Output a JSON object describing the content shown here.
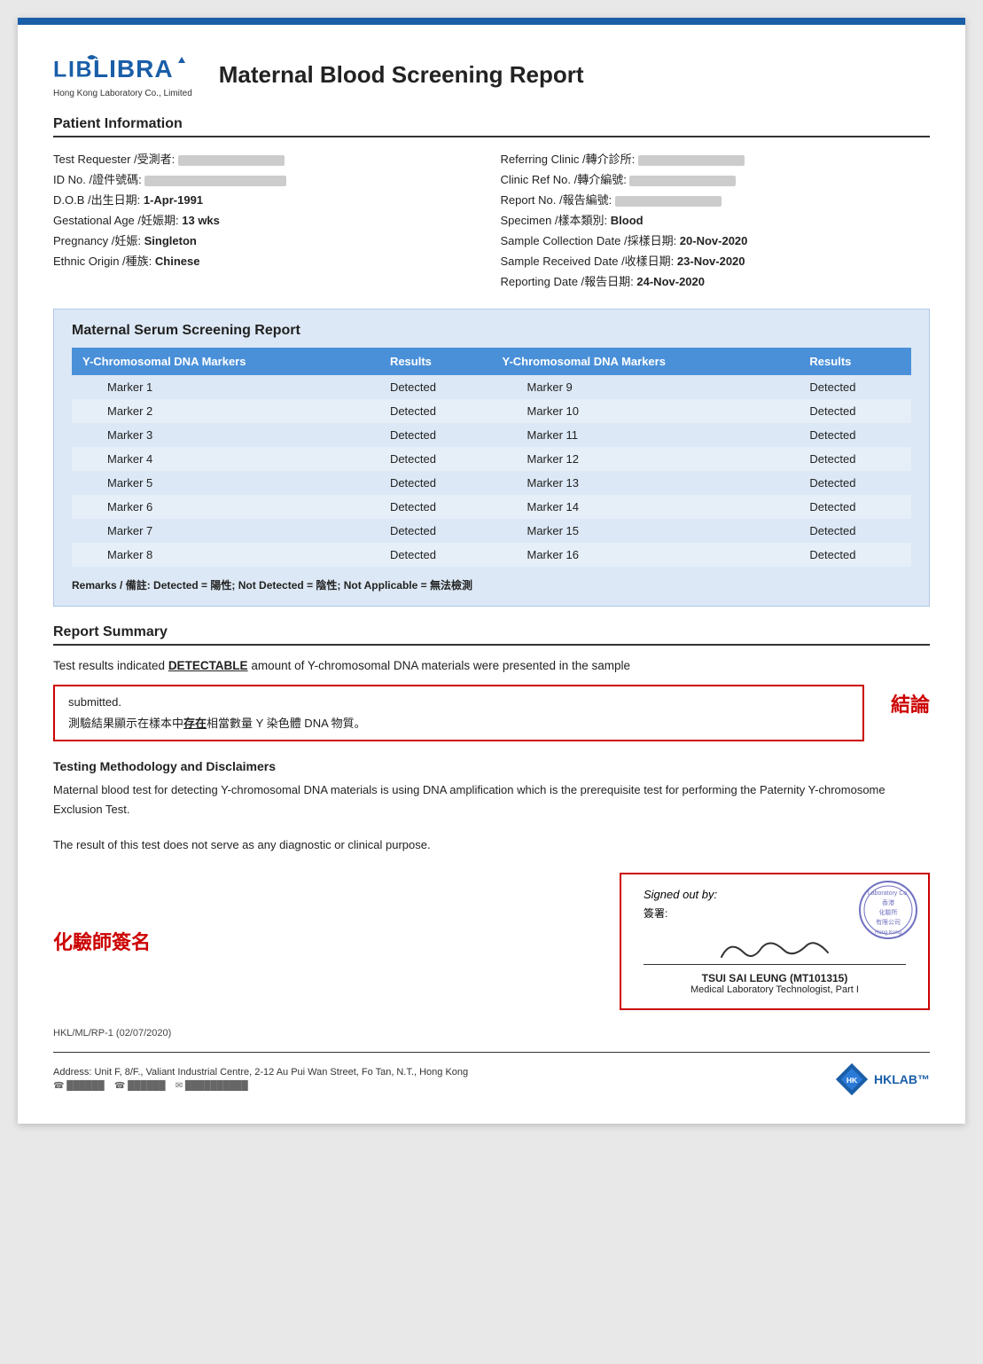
{
  "page": {
    "title": "Maternal Blood Screening Report"
  },
  "logo": {
    "name": "LIBRA",
    "subtitle": "Hong Kong Laboratory Co., Limited"
  },
  "patient_info": {
    "section_title": "Patient Information",
    "fields_left": [
      {
        "label": "Test Requester /受測者:",
        "value": "████████"
      },
      {
        "label": "ID No. /證件號碼:",
        "value": "████████████"
      },
      {
        "label": "D.O.B /出生日期:",
        "value": "1-Apr-1991"
      },
      {
        "label": "Gestational Age /妊娠期:",
        "value": "13 wks"
      },
      {
        "label": "Pregnancy /妊娠:",
        "value": "Singleton"
      },
      {
        "label": "Ethnic Origin /種族:",
        "value": "Chinese"
      }
    ],
    "fields_right": [
      {
        "label": "Referring Clinic /轉介診所:",
        "value": "████████"
      },
      {
        "label": "Clinic Ref No. /轉介編號:",
        "value": "████████"
      },
      {
        "label": "Report No. /報告編號:",
        "value": "████████"
      },
      {
        "label": "Specimen /樣本類別:",
        "value": "Blood"
      },
      {
        "label": "Sample Collection Date /採樣日期:",
        "value": "20-Nov-2020"
      },
      {
        "label": "Sample Received Date /收樣日期:",
        "value": "23-Nov-2020"
      },
      {
        "label": "Reporting Date /報告日期:",
        "value": "24-Nov-2020"
      }
    ]
  },
  "serum_section": {
    "title": "Maternal Serum Screening Report",
    "col1_header": "Y-Chromosomal DNA Markers",
    "col2_header": "Results",
    "col3_header": "Y-Chromosomal DNA Markers",
    "col4_header": "Results",
    "markers_left": [
      {
        "marker": "Marker 1",
        "result": "Detected"
      },
      {
        "marker": "Marker 2",
        "result": "Detected"
      },
      {
        "marker": "Marker 3",
        "result": "Detected"
      },
      {
        "marker": "Marker 4",
        "result": "Detected"
      },
      {
        "marker": "Marker 5",
        "result": "Detected"
      },
      {
        "marker": "Marker 6",
        "result": "Detected"
      },
      {
        "marker": "Marker 7",
        "result": "Detected"
      },
      {
        "marker": "Marker 8",
        "result": "Detected"
      }
    ],
    "markers_right": [
      {
        "marker": "Marker 9",
        "result": "Detected"
      },
      {
        "marker": "Marker 10",
        "result": "Detected"
      },
      {
        "marker": "Marker 11",
        "result": "Detected"
      },
      {
        "marker": "Marker 12",
        "result": "Detected"
      },
      {
        "marker": "Marker 13",
        "result": "Detected"
      },
      {
        "marker": "Marker 14",
        "result": "Detected"
      },
      {
        "marker": "Marker 15",
        "result": "Detected"
      },
      {
        "marker": "Marker 16",
        "result": "Detected"
      }
    ],
    "remarks": "Remarks / 備註: Detected = 陽性; Not Detected = 陰性; Not Applicable = 無法檢測"
  },
  "report_summary": {
    "section_title": "Report Summary",
    "text_line1": "Test results indicated ",
    "detectable": "DETECTABLE",
    "text_line2": " amount of Y-chromosomal DNA materials were presented in the sample",
    "submitted": "submitted.",
    "chinese_text_pre": "測驗結果顯示在樣本中",
    "chinese_underline": "存在",
    "chinese_text_post": "相當數量 Y 染色體 DNA 物質。",
    "conclusion_label": "結論"
  },
  "methodology": {
    "title": "Testing Methodology and Disclaimers",
    "text1": "Maternal blood test for detecting Y-chromosomal DNA materials is using DNA amplification which is the prerequisite test for performing the Paternity Y-chromosome Exclusion Test.",
    "text2": "The result of this test does not serve as any diagnostic or clinical purpose."
  },
  "signature": {
    "chemist_label": "化驗師簽名",
    "signed_out_by": "Signed out by:",
    "signed_chinese": "簽署:",
    "signer_name": "TSUI SAI LEUNG (MT101315)",
    "signer_title": "Medical Laboratory Technologist, Part I"
  },
  "footer": {
    "ref": "HKL/ML/RP-1 (02/07/2020)",
    "address": "Address: Unit F, 8/F., Valiant Industrial Centre, 2-12 Au Pui Wan Street, Fo Tan, N.T., Hong Kong",
    "hklab": "HKLAB™"
  }
}
